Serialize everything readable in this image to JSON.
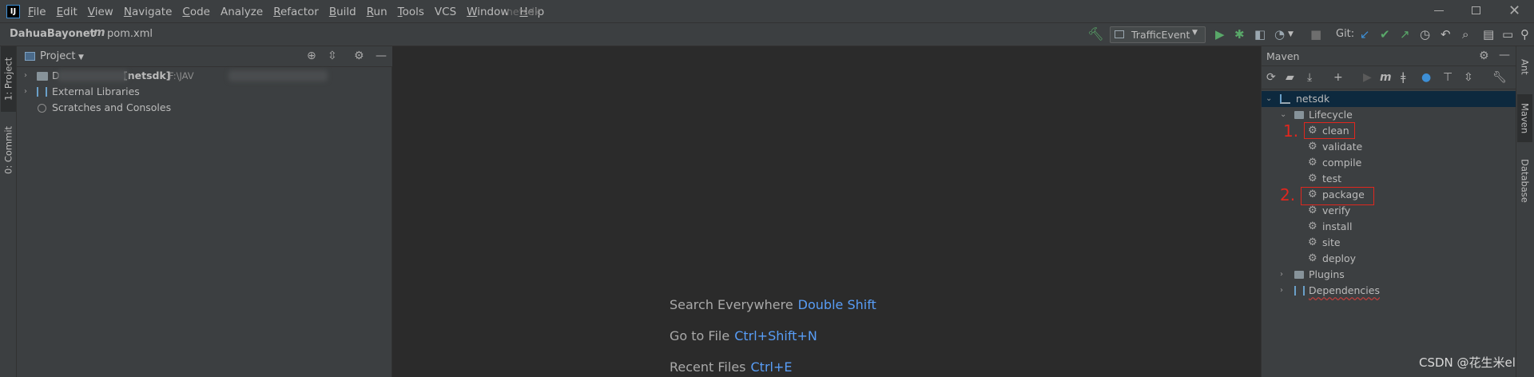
{
  "menubar": {
    "app_icon": "intellij-logo-icon",
    "logo_text": "IJ",
    "items": [
      "File",
      "Edit",
      "View",
      "Navigate",
      "Code",
      "Analyze",
      "Refactor",
      "Build",
      "Run",
      "Tools",
      "VCS",
      "Window",
      "Help"
    ],
    "project_title": "netsdk"
  },
  "navbar": {
    "breadcrumb_project": "DahuaBayonet",
    "breadcrumb_file": "pom.xml",
    "run_config": "TrafficEvent",
    "git_label": "Git:"
  },
  "left_tools": {
    "project_tab": "1: Project",
    "commit_tab": "0: Commit"
  },
  "project_panel": {
    "title": "Project",
    "tree": [
      {
        "label_prefix": "D",
        "label_module": "[netsdk]",
        "label_path": "F:\\JAV"
      },
      {
        "label": "External Libraries"
      },
      {
        "label": "Scratches and Consoles"
      }
    ]
  },
  "editor": {
    "hints": [
      {
        "action": "Search Everywhere",
        "key": "Double Shift"
      },
      {
        "action": "Go to File",
        "key": "Ctrl+Shift+N"
      },
      {
        "action": "Recent Files",
        "key": "Ctrl+E"
      }
    ]
  },
  "maven_panel": {
    "title": "Maven",
    "root": "netsdk",
    "lifecycle_label": "Lifecycle",
    "lifecycle_goals": [
      "clean",
      "validate",
      "compile",
      "test",
      "package",
      "verify",
      "install",
      "site",
      "deploy"
    ],
    "plugins_label": "Plugins",
    "dependencies_label": "Dependencies",
    "annotations": [
      "1.",
      "2."
    ]
  },
  "right_tools": {
    "ant_tab": "Ant",
    "maven_tab": "Maven",
    "database_tab": "Database"
  },
  "watermark": "CSDN @花生米el",
  "colors": {
    "background": "#2b2b2b",
    "panel": "#3c3f41",
    "accent_blue": "#589df6",
    "annotation_red": "#e0271e",
    "run_green": "#59a869"
  }
}
